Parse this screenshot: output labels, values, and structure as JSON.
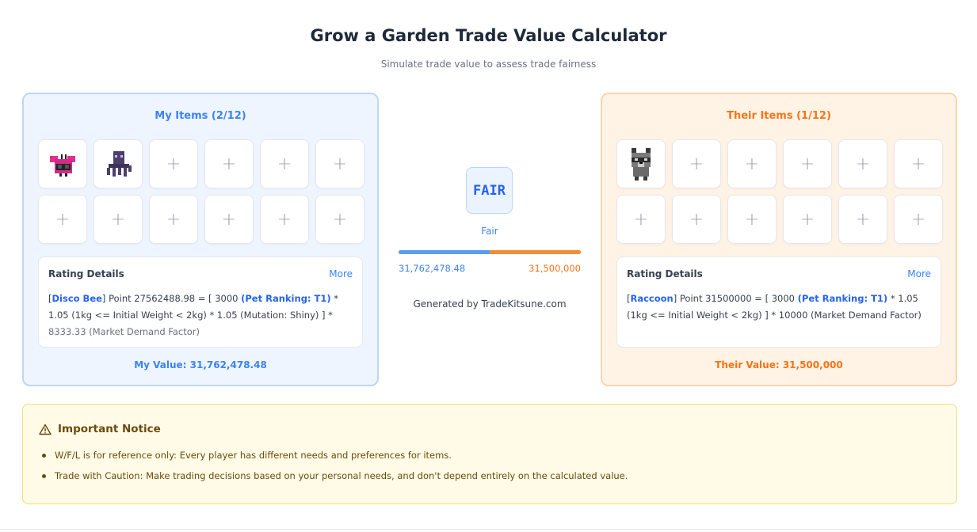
{
  "header": {
    "title": "Grow a Garden Trade Value Calculator",
    "subtitle": "Simulate trade value to assess trade fairness"
  },
  "my_items": {
    "title": "My Items (2/12)",
    "items": [
      {
        "name": "Disco Bee",
        "icon": "disco-bee-icon"
      },
      {
        "name": "Squid",
        "icon": "squid-icon"
      }
    ],
    "empty_slot_label": "+",
    "rating": {
      "title": "Rating Details",
      "more": "More",
      "item_name": "Disco Bee",
      "pre": "Point 27562488.98 = [ 3000 ",
      "ranking": "(Pet Ranking: T1)",
      "formula": " * 1.05 (1kg <= Initial Weight < 2kg) * 1.05 (Mutation: Shiny) ] * ",
      "demand": "8333.33 (Market Demand Factor)"
    },
    "value_label": "My Value: 31,762,478.48"
  },
  "their_items": {
    "title": "Their Items (1/12)",
    "items": [
      {
        "name": "Raccoon",
        "icon": "raccoon-icon"
      }
    ],
    "empty_slot_label": "+",
    "rating": {
      "title": "Rating Details",
      "more": "More",
      "item_name": "Raccoon",
      "pre": "Point 31500000 = [ 3000 ",
      "ranking": "(Pet Ranking: T1)",
      "formula": " * 1.05 (1kg <= Initial Weight < 2kg) ] * 10000 (Market Demand Factor)"
    },
    "value_label": "Their Value: 31,500,000"
  },
  "result": {
    "badge": "FAIR",
    "verdict": "Fair",
    "my_value": "31,762,478.48",
    "their_value": "31,500,000",
    "my_share": 0.502,
    "generated_by": "Generated by TradeKitsune.com"
  },
  "notice": {
    "title": "Important Notice",
    "items": [
      "W/F/L is for reference only: Every player has different needs and preferences for items.",
      "Trade with Caution: Make trading decisions based on your personal needs, and don't depend entirely on the calculated value."
    ]
  },
  "colors": {
    "my_accent": "#3b82f6",
    "their_accent": "#f97316",
    "notice_bg": "#fffbe6"
  }
}
